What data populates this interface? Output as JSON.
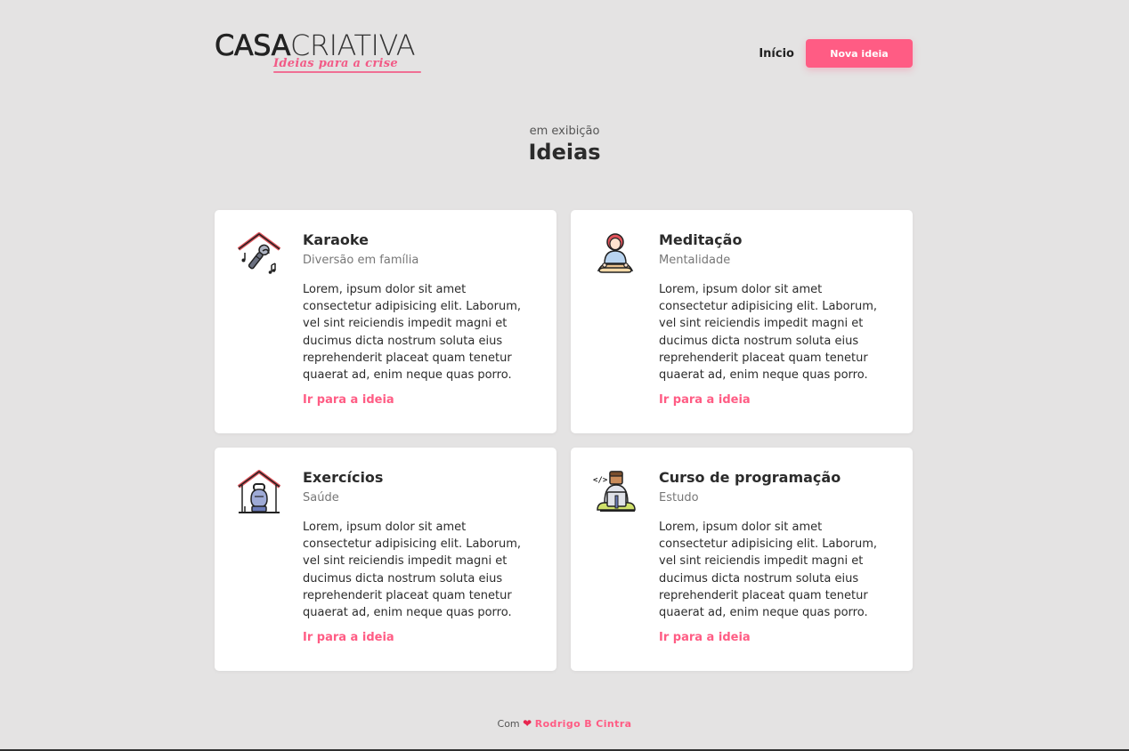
{
  "header": {
    "logo_part1": "CASA",
    "logo_part2": "CRIATIVA",
    "logo_tagline": "Ideias para a crise",
    "nav_home": "Início",
    "new_idea_button": "Nova ideia"
  },
  "section": {
    "eyebrow": "em exibição",
    "title": "Ideias"
  },
  "ideas": [
    {
      "title": "Karaoke",
      "category": "Diversão em família",
      "description": "Lorem, ipsum dolor sit amet consectetur adipisicing elit. Laborum, vel sint reiciendis impedit magni et ducimus dicta nostrum soluta eius reprehenderit placeat quam tenetur quaerat ad, enim neque quas porro.",
      "link": "Ir para a ideia",
      "icon": "karaoke-house-microphone-icon"
    },
    {
      "title": "Meditação",
      "category": "Mentalidade",
      "description": "Lorem, ipsum dolor sit amet consectetur adipisicing elit. Laborum, vel sint reiciendis impedit magni et ducimus dicta nostrum soluta eius reprehenderit placeat quam tenetur quaerat ad, enim neque quas porro.",
      "link": "Ir para a ideia",
      "icon": "meditation-person-icon"
    },
    {
      "title": "Exercícios",
      "category": "Saúde",
      "description": "Lorem, ipsum dolor sit amet consectetur adipisicing elit. Laborum, vel sint reiciendis impedit magni et ducimus dicta nostrum soluta eius reprehenderit placeat quam tenetur quaerat ad, enim neque quas porro.",
      "link": "Ir para a ideia",
      "icon": "exercise-house-kettlebell-icon"
    },
    {
      "title": "Curso de programação",
      "category": "Estudo",
      "description": "Lorem, ipsum dolor sit amet consectetur adipisicing elit. Laborum, vel sint reiciendis impedit magni et ducimus dicta nostrum soluta eius reprehenderit placeat quam tenetur quaerat ad, enim neque quas porro.",
      "link": "Ir para a ideia",
      "icon": "programmer-laptop-icon"
    }
  ],
  "footer": {
    "prefix": "Com",
    "heart": "❤",
    "author": "Rodrigo B Cintra"
  },
  "colors": {
    "background": "#e4e3e3",
    "accent": "#ff5c84",
    "card": "#ffffff"
  }
}
